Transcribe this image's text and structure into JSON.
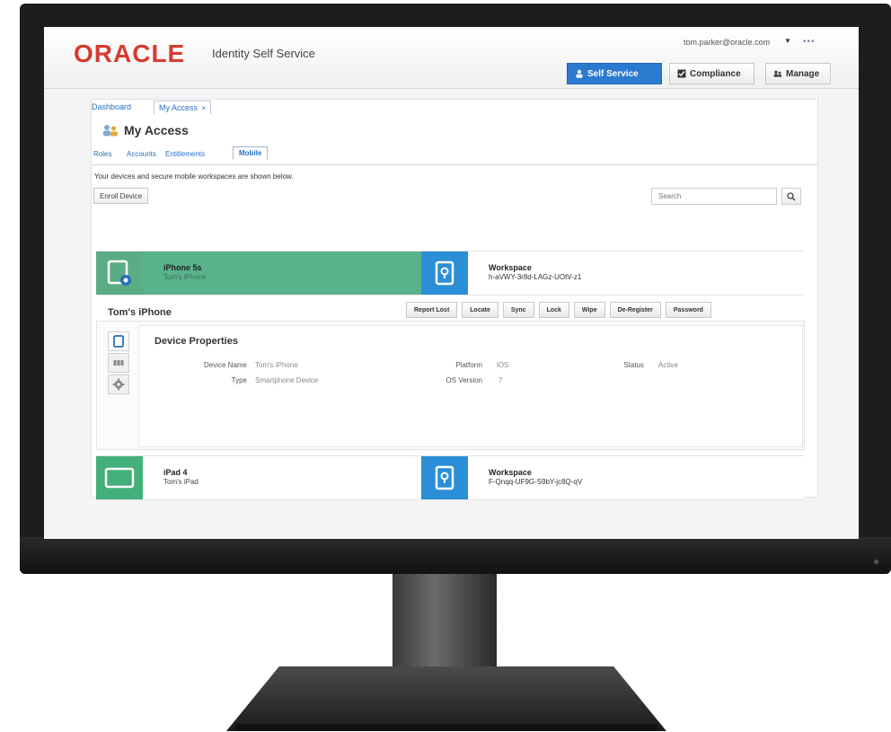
{
  "header": {
    "logo": "ORACLE",
    "app_title": "Identity Self Service",
    "user": "tom.parker@oracle.com",
    "user_caret": "▼",
    "more": "•••",
    "nav": [
      {
        "label": "Self Service",
        "icon": "person-icon"
      },
      {
        "label": "Compliance",
        "icon": "checklist-icon"
      },
      {
        "label": "Manage",
        "icon": "users-icon"
      }
    ]
  },
  "breadcrumbs": {
    "dashboard": "Dashboard",
    "my_access": "My Access",
    "close": "×"
  },
  "page": {
    "title": "My Access",
    "icon": "users-icon"
  },
  "tabs": [
    "Roles",
    "Accounts",
    "Entitlements",
    "Mobile"
  ],
  "description": "Your devices and secure mobile workspaces are shown below.",
  "enroll_label": "Enroll Device",
  "search": {
    "placeholder": "Search",
    "icon": "search-icon"
  },
  "devices": [
    {
      "name": "iPhone 5s",
      "owner": "Tom's iPhone",
      "icon": "phone-gear-icon",
      "workspace_title": "Workspace",
      "workspace_id": "h-aVWY-3r8d-LAGz-UOtV-z1",
      "workspace_icon": "lock-icon"
    },
    {
      "name": "iPad 4",
      "owner": "Tom's iPad",
      "icon": "tablet-icon",
      "workspace_title": "Workspace",
      "workspace_id": "F-Qnqq-UF9G-S9bY-jc8Q-qV",
      "workspace_icon": "lock-icon"
    }
  ],
  "details": {
    "title": "Tom's iPhone",
    "actions": [
      "Report Lost",
      "Locate",
      "Sync",
      "Lock",
      "Wipe",
      "De-Register",
      "Password"
    ],
    "section_title": "Device Properties",
    "properties": {
      "device_name_label": "Device Name",
      "device_name": "Tom's iPhone",
      "type_label": "Type",
      "type": "Smartphone Device",
      "platform_label": "Platform",
      "platform": "iOS",
      "os_version_label": "OS Version",
      "os_version": "7",
      "status_label": "Status",
      "status": "Active"
    },
    "side_icons": [
      "device-icon",
      "apps-icon",
      "gear-icon"
    ]
  },
  "colors": {
    "oracle_red": "#d63b2f",
    "accent_blue": "#2c7ad0",
    "device_green": "#58b38c",
    "workspace_blue": "#2b8fd8"
  }
}
